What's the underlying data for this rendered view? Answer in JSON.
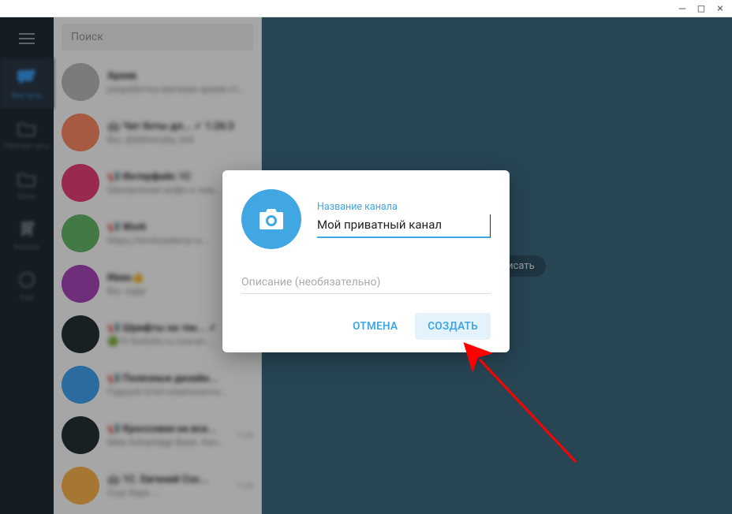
{
  "window": {
    "minimize_glyph": "—",
    "maximize_glyph": "□",
    "close_glyph": "×"
  },
  "rail": {
    "items": [
      {
        "label": "Все чаты"
      },
      {
        "label": "Рабочие чаты"
      },
      {
        "label": "Боты"
      },
      {
        "label": "Каналы"
      },
      {
        "label": "Ещё"
      }
    ]
  },
  "search": {
    "placeholder": "Поиск"
  },
  "chats": [
    {
      "avatar_color": "#bdbdbd",
      "title": "Архив",
      "sub": "разработка магазин архив стр...",
      "meta": ""
    },
    {
      "avatar_color": "#ff8a65",
      "title": "🤖 Чат боты дл...  ✓ 1:26:3",
      "sub": "Вы: @deliveryby_bot",
      "meta": ""
    },
    {
      "avatar_color": "#ec407a",
      "title": "📢 Интерфейс 1С",
      "sub": "Обновление инфо о том...",
      "meta": ""
    },
    {
      "avatar_color": "#66bb6a",
      "title": "📢 Work",
      "sub": "https://timAcademy.ru ...",
      "meta": ""
    },
    {
      "avatar_color": "#ab47bc",
      "title": "Иван👍",
      "sub": "Вы: куда",
      "meta": ""
    },
    {
      "avatar_color": "#263238",
      "title": "📢 Шрифты на тек...  ✓",
      "sub": "🟢 fr-fontsite.ru скачат...",
      "meta": ""
    },
    {
      "avatar_color": "#42a5f5",
      "title": "📢 Полезные дизайн...",
      "sub": "Годный UI kit компоненто...",
      "meta": ""
    },
    {
      "avatar_color": "#263238",
      "title": "📢 Кроссовки на все...",
      "sub": "Nike Advantage Base. Кач...",
      "meta": "7:20"
    },
    {
      "avatar_color": "#ffb74d",
      "title": "🤖 1С. Евгений Сос...",
      "sub": "Сыр бери ...",
      "meta": "7:20"
    }
  ],
  "main": {
    "hint_text": "ли бы написать"
  },
  "modal": {
    "name_label": "Название канала",
    "name_value": "Мой приватный канал",
    "desc_placeholder": "Описание (необязательно)",
    "cancel_label": "ОТМЕНА",
    "create_label": "СОЗДАТЬ"
  },
  "colors": {
    "accent": "#40a7e3",
    "rail_bg": "#212b35",
    "main_bg": "#3e6a82"
  }
}
